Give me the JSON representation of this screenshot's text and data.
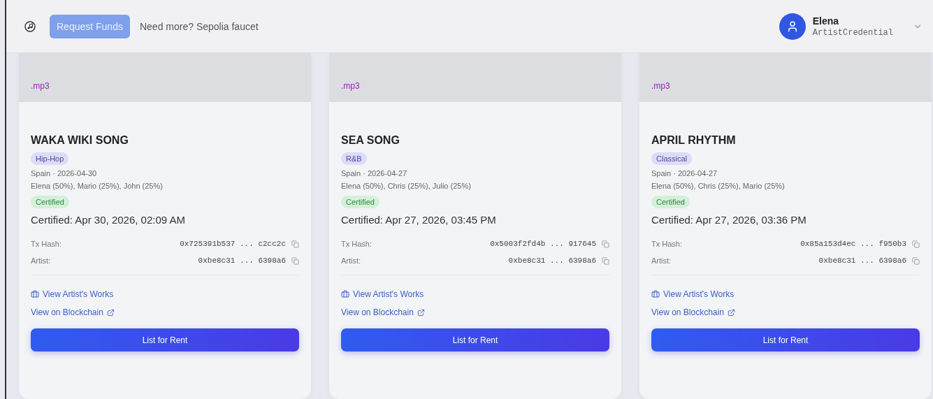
{
  "header": {
    "request_button": "Request Funds",
    "faucet_link": "Need more? Sepolia faucet",
    "user": {
      "name": "Elena",
      "role": "ArtistCredential"
    }
  },
  "cards": [
    {
      "format": ".mp3",
      "title": "WAKA WIKI SONG",
      "genre": "Hip-Hop",
      "meta": "Spain · 2026-04-30",
      "splits": "Elena (50%), Mario (25%), John (25%)",
      "status": "Certified",
      "certified_at": "Certified: Apr 30, 2026, 02:09 AM",
      "fields": [
        {
          "label": "Tx Hash:",
          "value": "0x725391b537 ... c2cc2c"
        },
        {
          "label": "Artist:",
          "value": "0xbe8c31 ... 6398a6"
        }
      ],
      "works_link": "View Artist's Works",
      "chain_link": "View on Blockchain",
      "button": "List for Rent"
    },
    {
      "format": ".mp3",
      "title": "SEA SONG",
      "genre": "R&B",
      "meta": "Spain · 2026-04-27",
      "splits": "Elena (50%), Chris (25%), Julio (25%)",
      "status": "Certified",
      "certified_at": "Certified: Apr 27, 2026, 03:45 PM",
      "fields": [
        {
          "label": "Tx Hash:",
          "value": "0x5003f2fd4b ... 917645"
        },
        {
          "label": "Artist:",
          "value": "0xbe8c31 ... 6398a6"
        }
      ],
      "works_link": "View Artist's Works",
      "chain_link": "View on Blockchain",
      "button": "List for Rent"
    },
    {
      "format": ".mp3",
      "title": "APRIL RHYTHM",
      "genre": "Classical",
      "meta": "Spain · 2026-04-27",
      "splits": "Elena (50%), Chris (25%), Mario (25%)",
      "status": "Certified",
      "certified_at": "Certified: Apr 27, 2026, 03:36 PM",
      "fields": [
        {
          "label": "Tx Hash:",
          "value": "0x85a153d4ec ... f950b3"
        },
        {
          "label": "Artist:",
          "value": "0xbe8c31 ... 6398a6"
        }
      ],
      "works_link": "View Artist's Works",
      "chain_link": "View on Blockchain",
      "button": "List for Rent"
    }
  ]
}
